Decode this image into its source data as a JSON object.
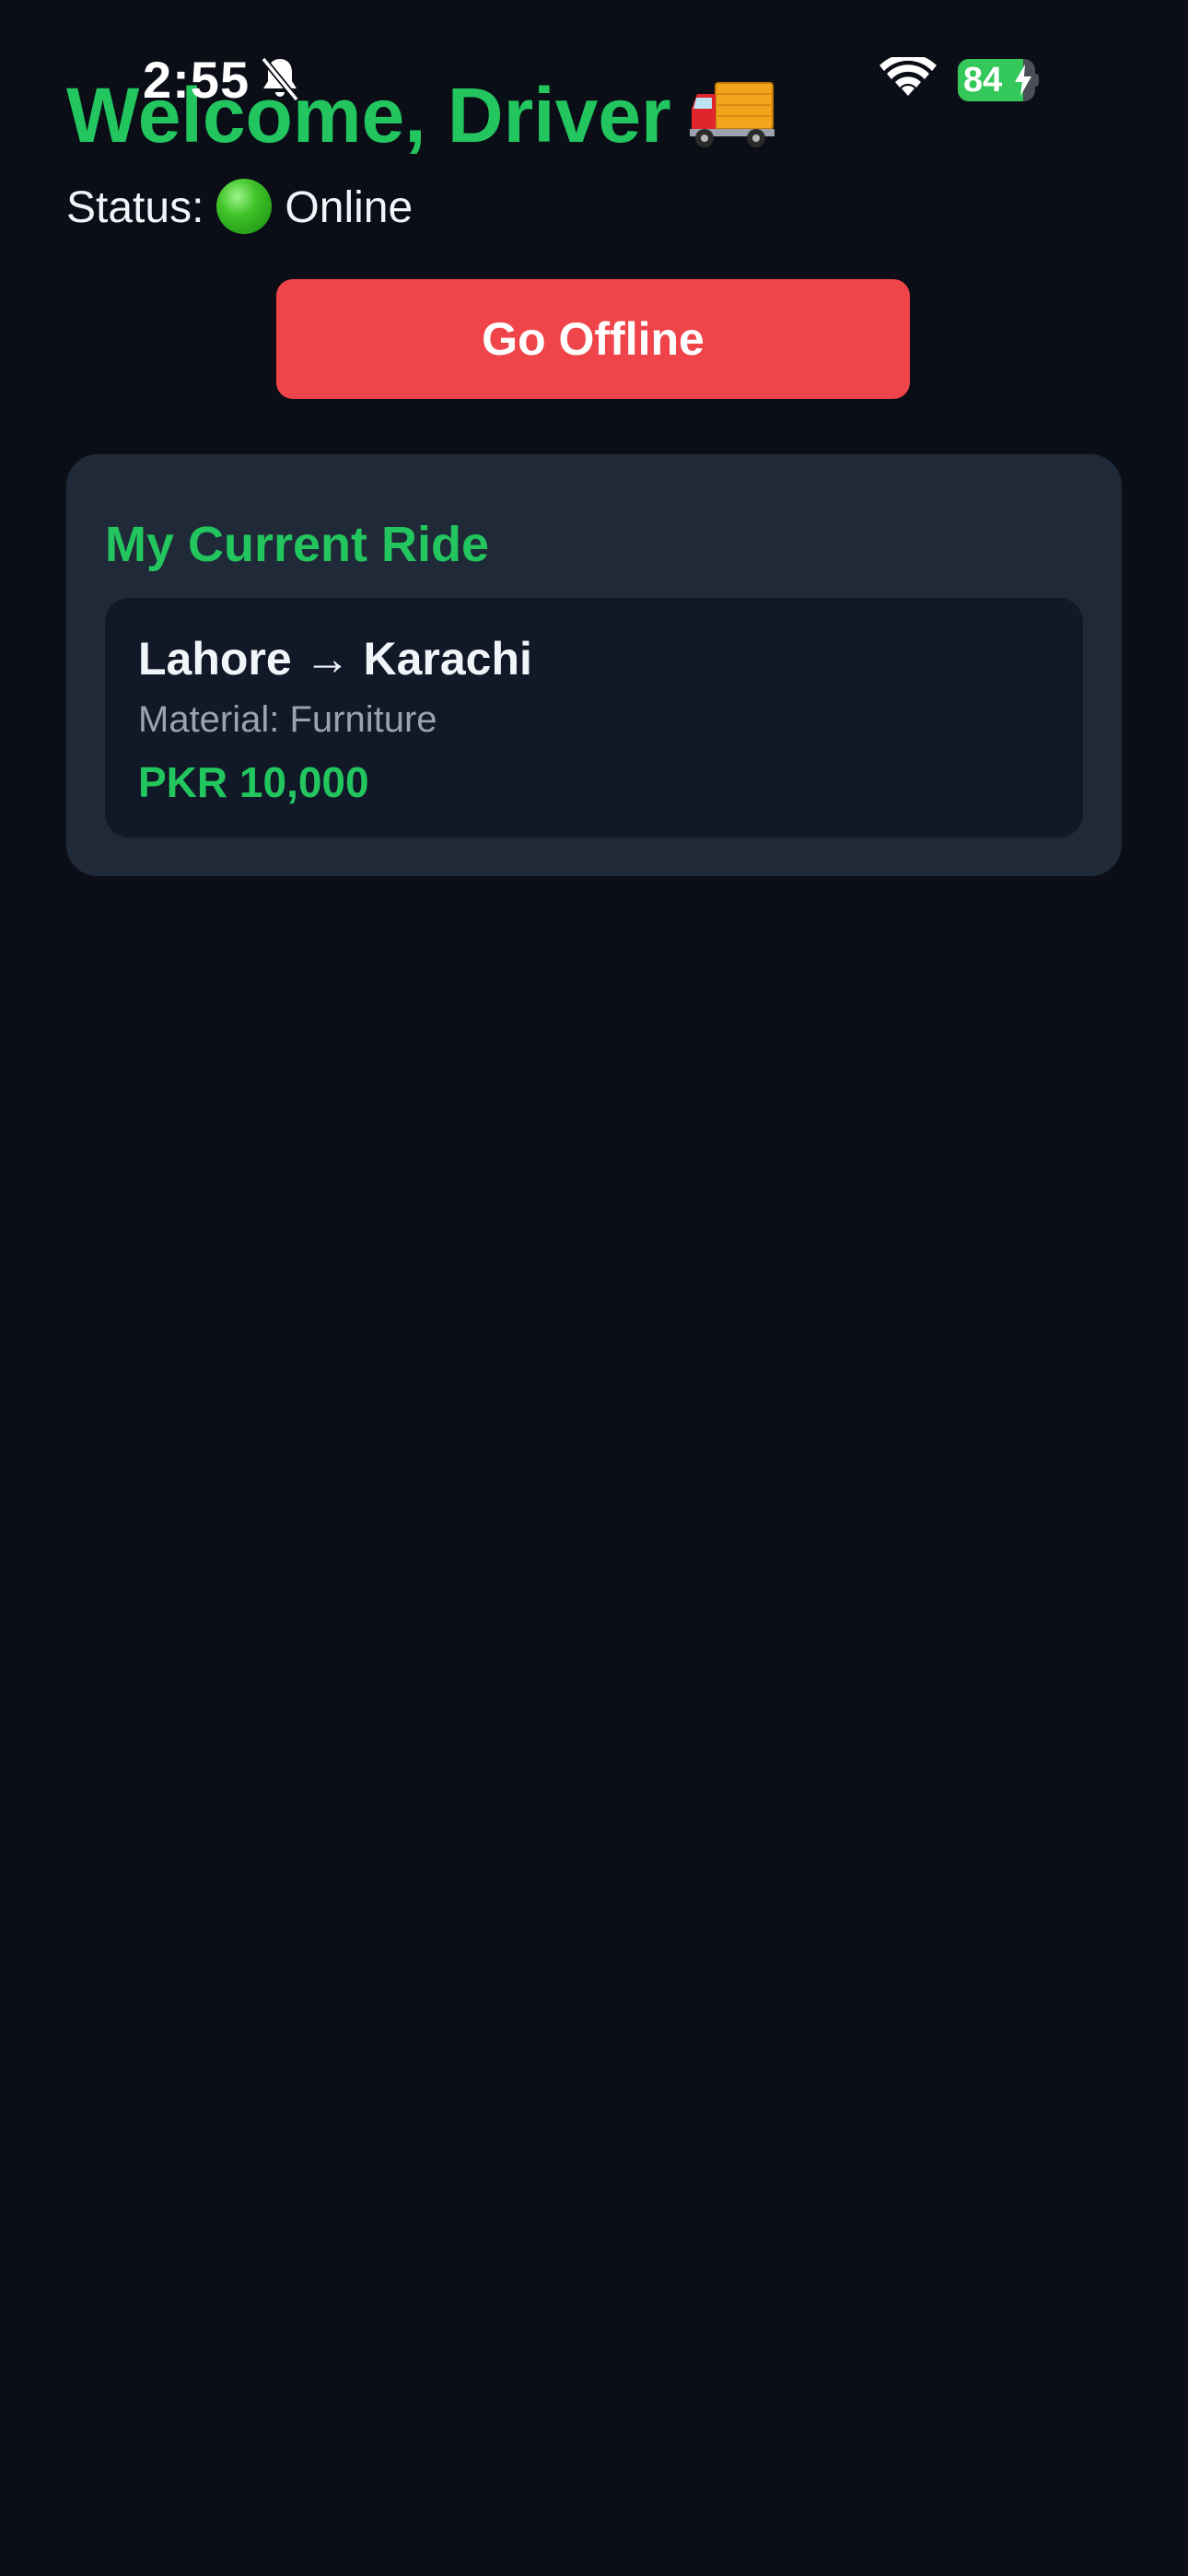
{
  "status_bar": {
    "time": "2:55",
    "battery_level": "84",
    "icons": [
      "bell-slash-icon",
      "wifi-icon",
      "battery-charging-icon"
    ]
  },
  "header": {
    "welcome": "Welcome, Driver",
    "welcome_icon": "truck-icon",
    "status_label": "Status:",
    "status_icon": "green-circle-icon",
    "status_value": "Online"
  },
  "actions": {
    "offline_button": "Go Offline"
  },
  "current_ride": {
    "title": "My Current Ride",
    "route": "Lahore → Karachi",
    "material": "Material: Furniture",
    "price": "PKR 10,000"
  },
  "colors": {
    "background": "#0b0e17",
    "accent_green": "#22c55e",
    "button_red": "#ef4449",
    "panel": "#1f2937",
    "card": "#111827",
    "battery_green": "#34c759"
  }
}
